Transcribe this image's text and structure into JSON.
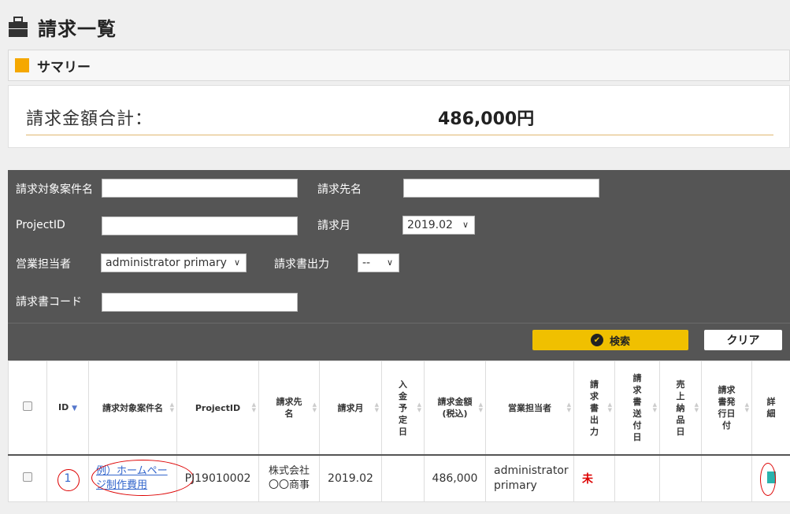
{
  "page": {
    "title": "請求一覧"
  },
  "summary": {
    "header": "サマリー",
    "total_label": "請求金額合計：",
    "total_value": "486,000円"
  },
  "search": {
    "case_name_label": "請求対象案件名",
    "billing_to_label": "請求先名",
    "project_id_label": "ProjectID",
    "billing_month_label": "請求月",
    "billing_month_value": "2019.02",
    "sales_rep_label": "営業担当者",
    "sales_rep_value": "administrator primary",
    "invoice_output_label": "請求書出力",
    "invoice_output_value": "--",
    "invoice_code_label": "請求書コード",
    "search_button": "検索",
    "clear_button": "クリア"
  },
  "table": {
    "headers": {
      "id": "ID",
      "case_name": "請求対象案件名",
      "project_id": "ProjectID",
      "billing_to": "請求先名",
      "billing_month": "請求月",
      "payment_date": "入金予定日",
      "amount": "請求金額(税込)",
      "sales_rep": "営業担当者",
      "invoice_output": "請求書出力",
      "invoice_send_date": "請求書送付日",
      "sales_delivery_date": "売上納品日",
      "invoice_issue_date": "請求書発行日付",
      "detail": "詳細"
    },
    "rows": [
      {
        "id": "1",
        "case_name": "例）ホームページ制作費用",
        "project_id": "PJ19010002",
        "billing_to": "株式会社〇〇商事",
        "billing_month": "2019.02",
        "payment_date": "",
        "amount": "486,000",
        "sales_rep": "administrator primary",
        "invoice_output": "未",
        "invoice_send_date": "",
        "sales_delivery_date": "",
        "invoice_issue_date": ""
      }
    ]
  },
  "icons": {
    "title_icon": "briefcase-icon",
    "search_icon": "check-circle-icon",
    "detail_icon": "document-icon"
  },
  "colors": {
    "accent": "#f5a800",
    "search_button": "#f0c000",
    "panel": "#555555",
    "link": "#3366cc",
    "alert": "#dd0000"
  }
}
